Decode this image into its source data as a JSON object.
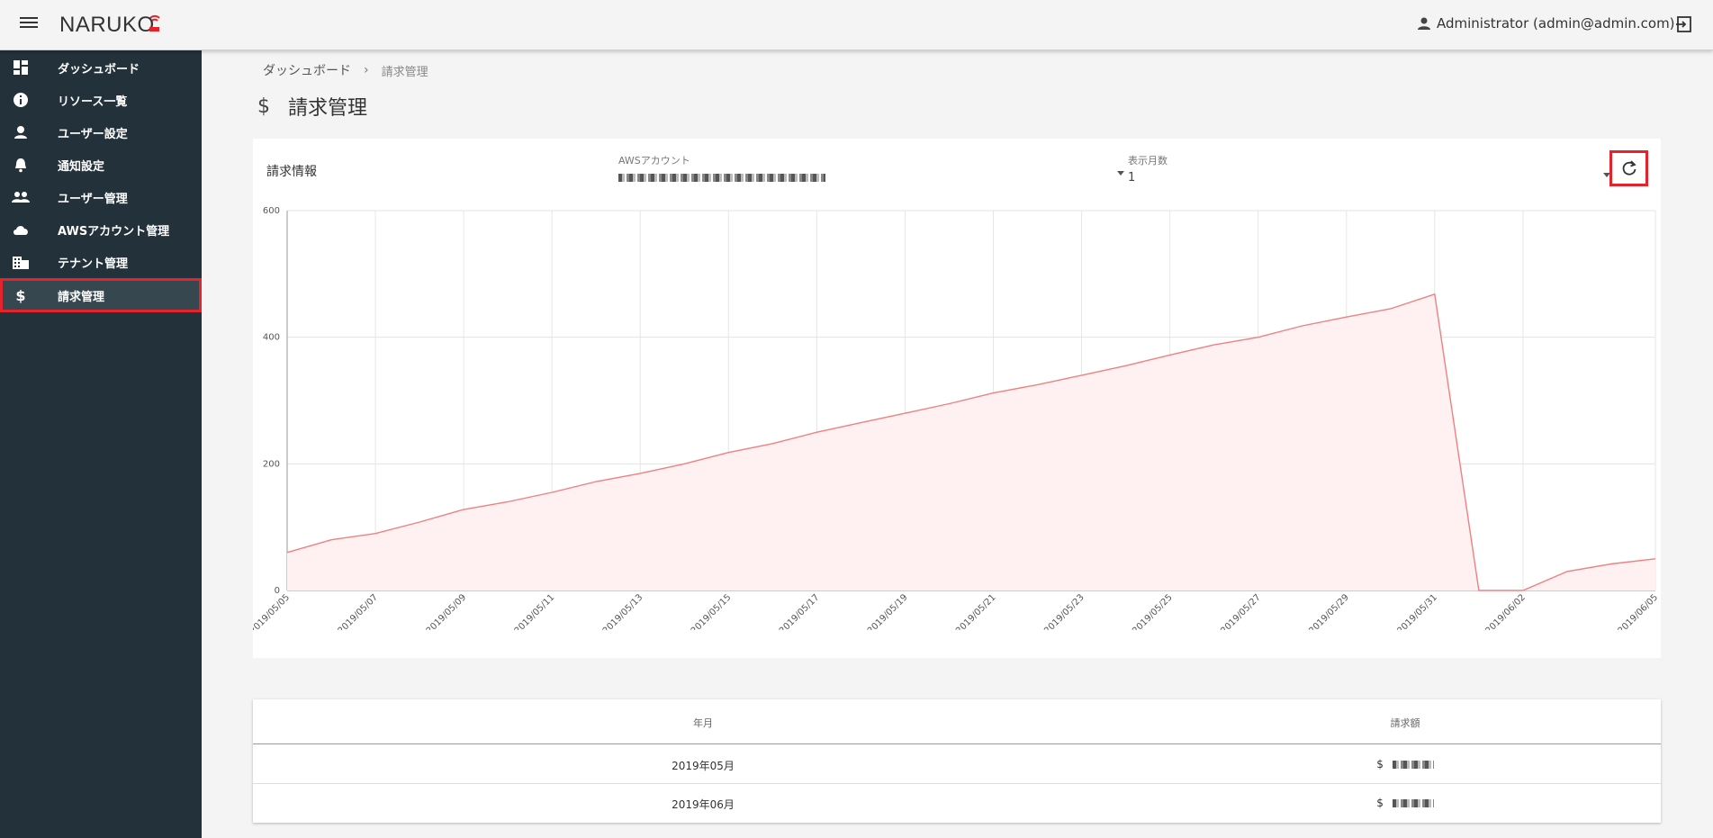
{
  "app": {
    "logo_text": "NARUKO"
  },
  "header": {
    "user_label": "Administrator (admin@admin.com)"
  },
  "sidebar": {
    "items": [
      {
        "label": "ダッシュボード",
        "icon": "dashboard-icon"
      },
      {
        "label": "リソース一覧",
        "icon": "info-icon"
      },
      {
        "label": "ユーザー設定",
        "icon": "person-icon"
      },
      {
        "label": "通知設定",
        "icon": "bell-icon"
      },
      {
        "label": "ユーザー管理",
        "icon": "people-icon"
      },
      {
        "label": "AWSアカウント管理",
        "icon": "cloud-icon"
      },
      {
        "label": "テナント管理",
        "icon": "building-icon"
      },
      {
        "label": "請求管理",
        "icon": "dollar-icon",
        "active": true
      }
    ]
  },
  "breadcrumb": {
    "home": "ダッシュボード",
    "separator": "›",
    "current": "請求管理"
  },
  "page": {
    "title_icon": "$",
    "title": "請求管理"
  },
  "billing": {
    "card_title": "請求情報",
    "aws_account_label": "AWSアカウント",
    "months_label": "表示月数",
    "months_value": "1"
  },
  "colors": {
    "accent": "#e5232d",
    "sidebar": "#23313a",
    "line": "#f08080",
    "fill": "#fff0f2"
  },
  "chart_data": {
    "type": "area",
    "x": [
      "2019/05/05",
      "2019/05/06",
      "2019/05/07",
      "2019/05/08",
      "2019/05/09",
      "2019/05/10",
      "2019/05/11",
      "2019/05/12",
      "2019/05/13",
      "2019/05/14",
      "2019/05/15",
      "2019/05/16",
      "2019/05/17",
      "2019/05/18",
      "2019/05/19",
      "2019/05/20",
      "2019/05/21",
      "2019/05/22",
      "2019/05/23",
      "2019/05/24",
      "2019/05/25",
      "2019/05/26",
      "2019/05/27",
      "2019/05/28",
      "2019/05/29",
      "2019/05/30",
      "2019/05/31",
      "2019/06/01",
      "2019/06/02",
      "2019/06/03",
      "2019/06/04",
      "2019/06/05"
    ],
    "x_ticks": [
      "2019/05/05",
      "2019/05/07",
      "2019/05/09",
      "2019/05/11",
      "2019/05/13",
      "2019/05/15",
      "2019/05/17",
      "2019/05/19",
      "2019/05/21",
      "2019/05/23",
      "2019/05/25",
      "2019/05/27",
      "2019/05/29",
      "2019/05/31",
      "2019/06/02",
      "2019/06/05"
    ],
    "values": [
      60,
      80,
      90,
      108,
      128,
      140,
      155,
      172,
      185,
      200,
      218,
      232,
      250,
      265,
      280,
      295,
      312,
      325,
      340,
      355,
      372,
      388,
      400,
      418,
      432,
      445,
      468,
      0,
      0,
      30,
      42,
      50
    ],
    "ylim": [
      0,
      600
    ],
    "y_ticks": [
      0,
      200,
      400,
      600
    ],
    "grid": true,
    "title": "",
    "xlabel": "",
    "ylabel": ""
  },
  "table": {
    "headers": [
      "年月",
      "請求額"
    ],
    "rows": [
      {
        "month": "2019年05月",
        "amount": "$"
      },
      {
        "month": "2019年06月",
        "amount": "$"
      }
    ]
  }
}
